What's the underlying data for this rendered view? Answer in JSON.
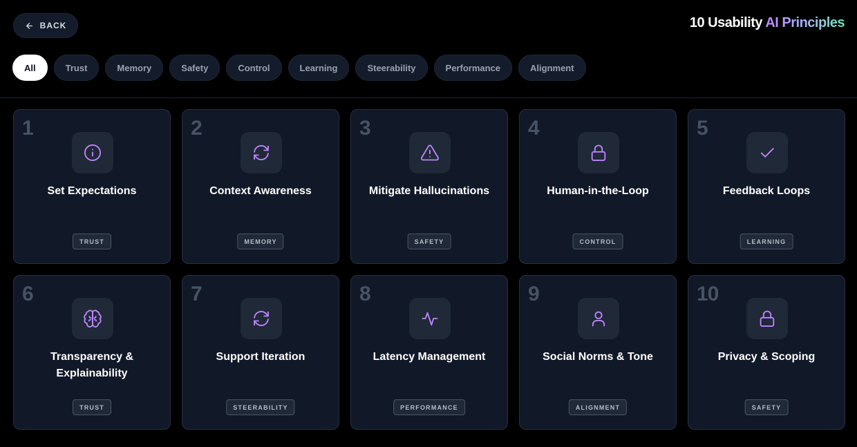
{
  "header": {
    "back_label": "BACK",
    "title_part1": "10 Usability",
    "title_part2": "AI Principles"
  },
  "filters": [
    "All",
    "Trust",
    "Memory",
    "Safety",
    "Control",
    "Learning",
    "Steerability",
    "Performance",
    "Alignment"
  ],
  "active_filter": "All",
  "colors": {
    "accent_icon": "#c084fc",
    "card_bg": "#111827",
    "page_bg": "#000000"
  },
  "cards": [
    {
      "number": "1",
      "title": "Set Expectations",
      "tag": "TRUST",
      "icon": "info-icon"
    },
    {
      "number": "2",
      "title": "Context Awareness",
      "tag": "MEMORY",
      "icon": "refresh-icon"
    },
    {
      "number": "3",
      "title": "Mitigate Hallucinations",
      "tag": "SAFETY",
      "icon": "warning-icon"
    },
    {
      "number": "4",
      "title": "Human-in-the-Loop",
      "tag": "CONTROL",
      "icon": "lock-icon"
    },
    {
      "number": "5",
      "title": "Feedback Loops",
      "tag": "LEARNING",
      "icon": "check-icon"
    },
    {
      "number": "6",
      "title": "Transparency & Explainability",
      "tag": "TRUST",
      "icon": "brain-icon"
    },
    {
      "number": "7",
      "title": "Support Iteration",
      "tag": "STEERABILITY",
      "icon": "refresh-icon"
    },
    {
      "number": "8",
      "title": "Latency Management",
      "tag": "PERFORMANCE",
      "icon": "activity-icon"
    },
    {
      "number": "9",
      "title": "Social Norms & Tone",
      "tag": "ALIGNMENT",
      "icon": "user-icon"
    },
    {
      "number": "10",
      "title": "Privacy & Scoping",
      "tag": "SAFETY",
      "icon": "lock-icon"
    }
  ]
}
